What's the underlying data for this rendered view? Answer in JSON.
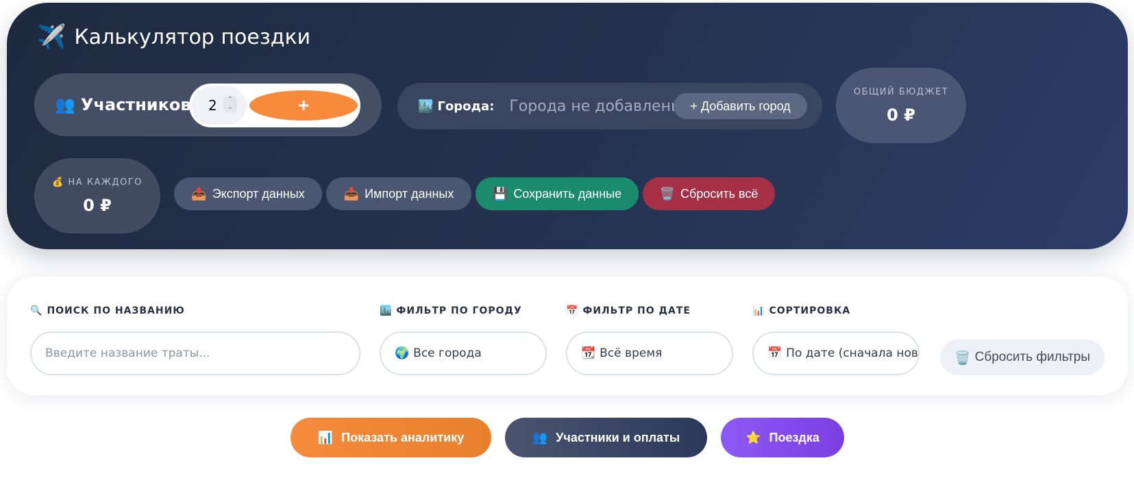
{
  "header": {
    "title": "Калькулятор поездки",
    "title_icon": "airplane-icon"
  },
  "participants": {
    "label": "Участников:",
    "icon": "people-icon",
    "value": "2",
    "add_label": "+"
  },
  "cities": {
    "label": "Города:",
    "icon": "cityscape-icon",
    "empty_text": "Города не добавлены",
    "add_button": "+ Добавить город"
  },
  "budget": {
    "caption": "ОБЩИЙ БЮДЖЕТ",
    "value": "0 ₽"
  },
  "per_person": {
    "caption": "НА КАЖДОГО",
    "icon": "money-bag-icon",
    "value": "0 ₽"
  },
  "actions": {
    "export": "Экспорт данных",
    "import": "Импорт данных",
    "save": "Сохранить данные",
    "reset": "Сбросить всё"
  },
  "filters": {
    "search_caption": "ПОИСК ПО НАЗВАНИЮ",
    "search_placeholder": "Введите название траты...",
    "city_caption": "ФИЛЬТР ПО ГОРОДУ",
    "city_value": "Все города",
    "date_caption": "ФИЛЬТР ПО ДАТЕ",
    "date_value": "Всё время",
    "sort_caption": "СОРТИРОВКА",
    "sort_value": "По дате (сначала новь",
    "reset_label": "Сбросить фильтры"
  },
  "tabs": {
    "analytics": "Показать аналитику",
    "participants": "Участники и оплаты",
    "trip": "Поездка"
  },
  "colors": {
    "accent_orange": "#f78a3b",
    "save_green": "#1b8b6d",
    "reset_red": "#a63045",
    "trip_purple": "#8d59f5"
  }
}
